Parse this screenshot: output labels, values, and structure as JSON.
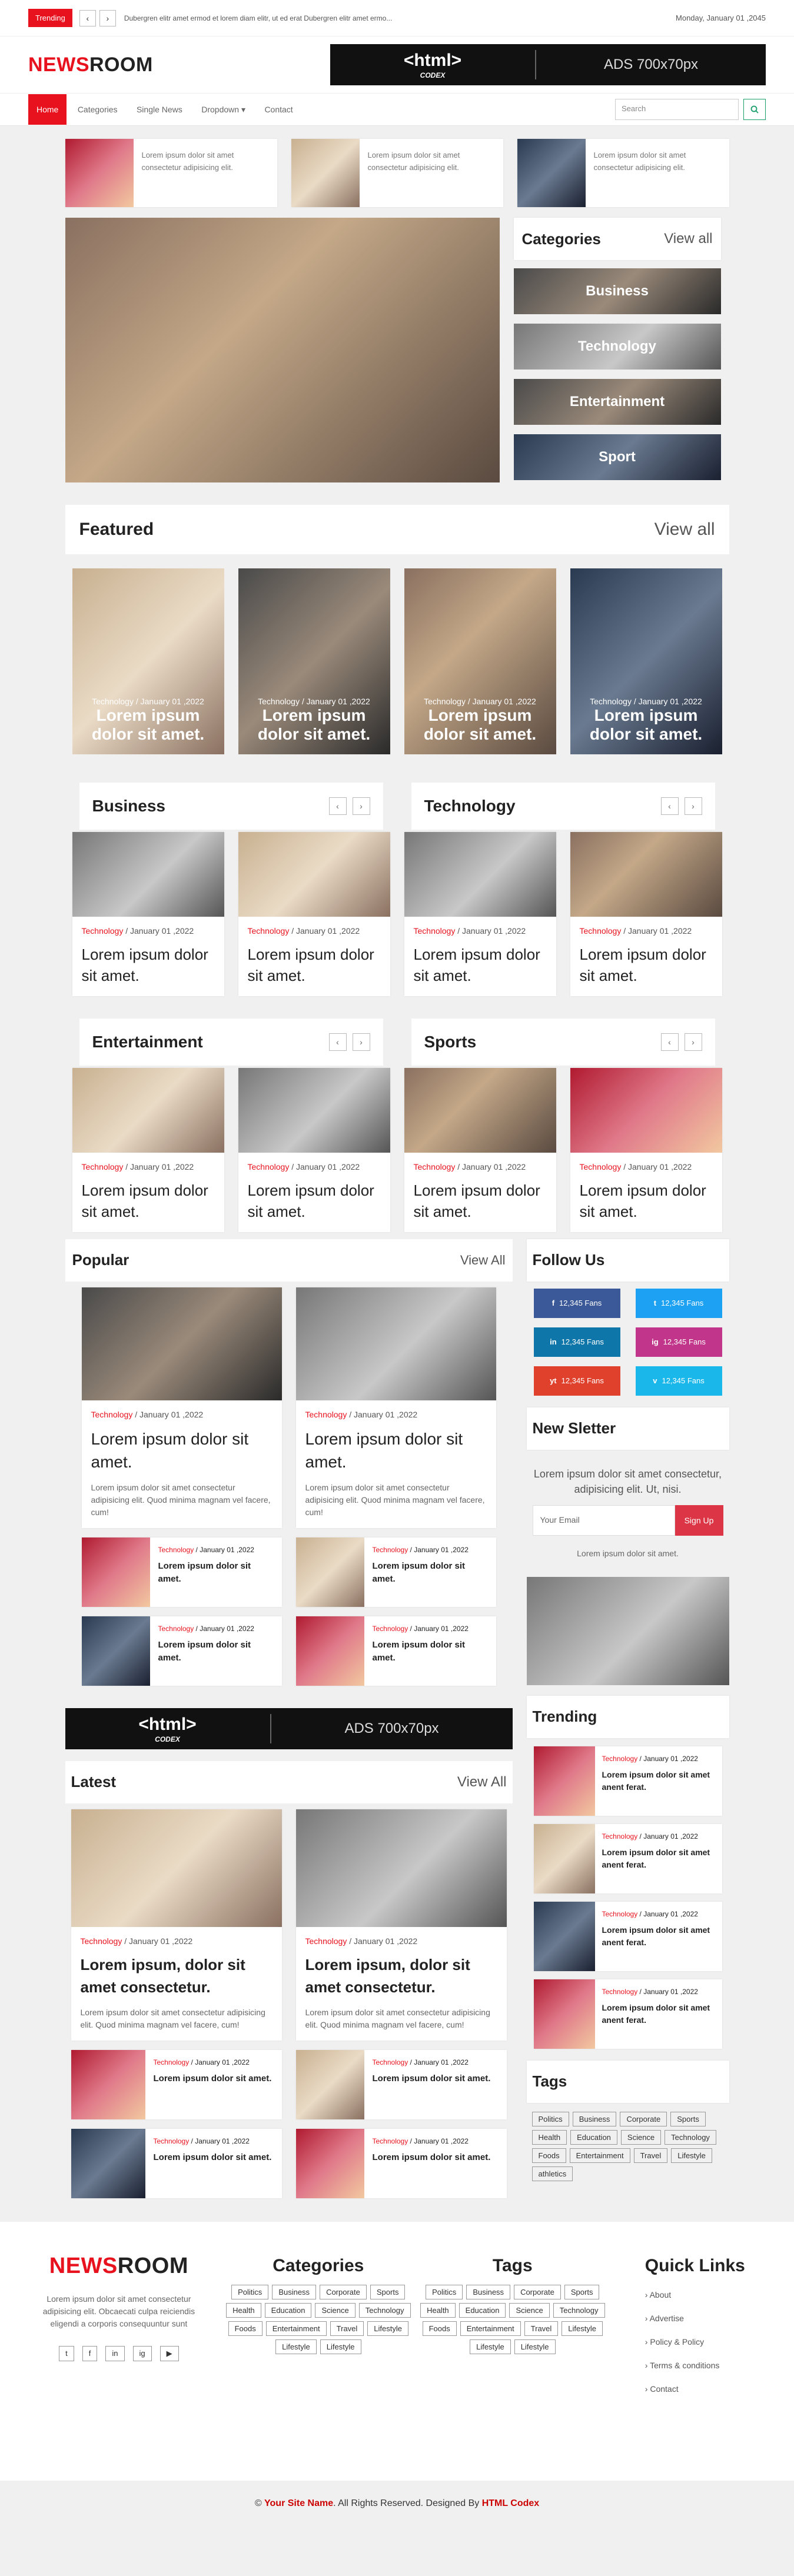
{
  "topbar": {
    "trending_label": "Trending",
    "ticker": "Dubergren elitr amet ermod et lorem diam elitr, ut ed erat Dubergren elitr amet ermo...",
    "date": "Monday, January 01 ,2045"
  },
  "brand": {
    "logo_a": "NEWS",
    "logo_b": "ROOM",
    "ads_brand": "<html>",
    "ads_sub": "CODEX",
    "ads_text": "ADS 700x70px"
  },
  "nav": {
    "items": [
      "Home",
      "Categories",
      "Single News",
      "Dropdown ▾",
      "Contact"
    ],
    "search_placeholder": "Search"
  },
  "top_cards": [
    {
      "text": "Lorem ipsum dolor sit amet consectetur adipisicing elit."
    },
    {
      "text": "Lorem ipsum dolor sit amet consectetur adipisicing elit."
    },
    {
      "text": "Lorem ipsum dolor sit amet consectetur adipisicing elit."
    }
  ],
  "categories": {
    "title": "Categories",
    "view_all": "View all",
    "items": [
      "Business",
      "Technology",
      "Entertainment",
      "Sport"
    ]
  },
  "featured": {
    "title": "Featured",
    "view_all": "View all",
    "items": [
      {
        "meta": "Technology / January 01 ,2022",
        "title": "Lorem ipsum dolor sit amet."
      },
      {
        "meta": "Technology / January 01 ,2022",
        "title": "Lorem ipsum dolor sit amet."
      },
      {
        "meta": "Technology / January 01 ,2022",
        "title": "Lorem ipsum dolor sit amet."
      },
      {
        "meta": "Technology / January 01 ,2022",
        "title": "Lorem ipsum dolor sit amet."
      }
    ]
  },
  "sections": [
    {
      "title": "Business",
      "items": [
        {
          "cat": "Technology",
          "date": " / January 01 ,2022",
          "title": "Lorem ipsum dolor sit amet."
        },
        {
          "cat": "Technology",
          "date": " / January 01 ,2022",
          "title": "Lorem ipsum dolor sit amet."
        }
      ]
    },
    {
      "title": "Technology",
      "items": [
        {
          "cat": "Technology",
          "date": " / January 01 ,2022",
          "title": "Lorem ipsum dolor sit amet."
        },
        {
          "cat": "Technology",
          "date": " / January 01 ,2022",
          "title": "Lorem ipsum dolor sit amet."
        }
      ]
    },
    {
      "title": "Entertainment",
      "items": [
        {
          "cat": "Technology",
          "date": " / January 01 ,2022",
          "title": "Lorem ipsum dolor sit amet."
        },
        {
          "cat": "Technology",
          "date": " / January 01 ,2022",
          "title": "Lorem ipsum dolor sit amet."
        }
      ]
    },
    {
      "title": "Sports",
      "items": [
        {
          "cat": "Technology",
          "date": " / January 01 ,2022",
          "title": "Lorem ipsum dolor sit amet."
        },
        {
          "cat": "Technology",
          "date": " / January 01 ,2022",
          "title": "Lorem ipsum dolor sit amet."
        }
      ]
    }
  ],
  "popular": {
    "title": "Popular",
    "view_all": "View All",
    "big": [
      {
        "cat": "Technology",
        "date": " / January 01 ,2022",
        "title": "Lorem ipsum dolor sit amet.",
        "desc": "Lorem ipsum dolor sit amet consectetur adipisicing elit. Quod minima magnam vel facere, cum!"
      },
      {
        "cat": "Technology",
        "date": " / January 01 ,2022",
        "title": "Lorem ipsum dolor sit amet.",
        "desc": "Lorem ipsum dolor sit amet consectetur adipisicing elit. Quod minima magnam vel facere, cum!"
      }
    ],
    "small": [
      {
        "cat": "Technology",
        "date": " / January 01 ,2022",
        "title": "Lorem ipsum dolor sit amet."
      },
      {
        "cat": "Technology",
        "date": " / January 01 ,2022",
        "title": "Lorem ipsum dolor sit amet."
      },
      {
        "cat": "Technology",
        "date": " / January 01 ,2022",
        "title": "Lorem ipsum dolor sit amet."
      },
      {
        "cat": "Technology",
        "date": " / January 01 ,2022",
        "title": "Lorem ipsum dolor sit amet."
      }
    ]
  },
  "latest": {
    "title": "Latest",
    "view_all": "View All",
    "big": [
      {
        "cat": "Technology",
        "date": " / January 01 ,2022",
        "title": "Lorem ipsum, dolor sit amet consectetur.",
        "desc": "Lorem ipsum dolor sit amet consectetur adipisicing elit. Quod minima magnam vel facere, cum!"
      },
      {
        "cat": "Technology",
        "date": " / January 01 ,2022",
        "title": "Lorem ipsum, dolor sit amet consectetur.",
        "desc": "Lorem ipsum dolor sit amet consectetur adipisicing elit. Quod minima magnam vel facere, cum!"
      }
    ],
    "small": [
      {
        "cat": "Technology",
        "date": " / January 01 ,2022",
        "title": "Lorem ipsum dolor sit amet."
      },
      {
        "cat": "Technology",
        "date": " / January 01 ,2022",
        "title": "Lorem ipsum dolor sit amet."
      },
      {
        "cat": "Technology",
        "date": " / January 01 ,2022",
        "title": "Lorem ipsum dolor sit amet."
      },
      {
        "cat": "Technology",
        "date": " / January 01 ,2022",
        "title": "Lorem ipsum dolor sit amet."
      }
    ]
  },
  "follow": {
    "title": "Follow Us",
    "items": [
      {
        "label": "12,345 Fans",
        "icon": "f",
        "color": "#3b5998"
      },
      {
        "label": "12,345 Fans",
        "icon": "t",
        "color": "#1da1f2"
      },
      {
        "label": "12,345 Fans",
        "icon": "in",
        "color": "#0e76a8"
      },
      {
        "label": "12,345 Fans",
        "icon": "ig",
        "color": "#c1358a"
      },
      {
        "label": "12,345 Fans",
        "icon": "yt",
        "color": "#e0412c"
      },
      {
        "label": "12,345 Fans",
        "icon": "v",
        "color": "#19b7ea"
      }
    ]
  },
  "newsletter": {
    "title": "New Sletter",
    "text": "Lorem ipsum dolor sit amet consectetur, adipisicing elit. Ut, nisi.",
    "placeholder": "Your Email",
    "button": "Sign Up",
    "note": "Lorem ipsum dolor sit amet."
  },
  "trending": {
    "title": "Trending",
    "items": [
      {
        "cat": "Technology",
        "date": " / January 01 ,2022",
        "title": "Lorem ipsum dolor sit amet anent ferat."
      },
      {
        "cat": "Technology",
        "date": " / January 01 ,2022",
        "title": "Lorem ipsum dolor sit amet anent ferat."
      },
      {
        "cat": "Technology",
        "date": " / January 01 ,2022",
        "title": "Lorem ipsum dolor sit amet anent ferat."
      },
      {
        "cat": "Technology",
        "date": " / January 01 ,2022",
        "title": "Lorem ipsum dolor sit amet anent ferat."
      }
    ]
  },
  "tags": {
    "title": "Tags",
    "items": [
      "Politics",
      "Business",
      "Corporate",
      "Sports",
      "Health",
      "Education",
      "Science",
      "Technology",
      "Foods",
      "Entertainment",
      "Travel",
      "Lifestyle",
      "athletics"
    ]
  },
  "footer": {
    "about": "Lorem ipsum dolor sit amet consectetur adipisicing elit. Obcaecati culpa reiciendis eligendi a corporis consequuntur sunt",
    "categories_title": "Categories",
    "categories": [
      "Politics",
      "Business",
      "Corporate",
      "Sports",
      "Health",
      "Education",
      "Science",
      "Technology",
      "Foods",
      "Entertainment",
      "Travel",
      "Lifestyle",
      "Lifestyle",
      "Lifestyle"
    ],
    "tags_title": "Tags",
    "tags": [
      "Politics",
      "Business",
      "Corporate",
      "Sports",
      "Health",
      "Education",
      "Science",
      "Technology",
      "Foods",
      "Entertainment",
      "Travel",
      "Lifestyle",
      "Lifestyle",
      "Lifestyle"
    ],
    "quick_title": "Quick Links",
    "quick": [
      "About",
      "Advertise",
      "Policy & Policy",
      "Terms & conditions",
      "Contact"
    ]
  },
  "copyright": {
    "a": "© ",
    "site": "Your Site Name",
    "b": ". All Rights Reserved. Designed By ",
    "designer": "HTML Codex"
  }
}
